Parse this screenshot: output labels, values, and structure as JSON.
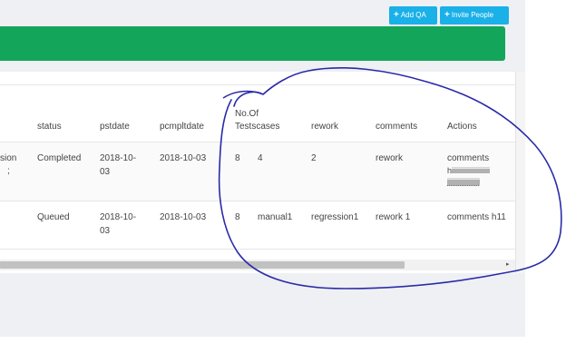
{
  "toolbar": {
    "add_qa_label": "Add QA",
    "invite_label": "Invite People",
    "plus_glyph": "+"
  },
  "table": {
    "headers": {
      "status": "status",
      "pstdate": "pstdate",
      "pcmpltdate": "pcmpltdate",
      "no_of_line1": "No.Of",
      "testcases": "Testscases",
      "rework": "rework",
      "comments": "comments",
      "actions": "Actions"
    },
    "rows": [
      {
        "partial_left_line1": "sion",
        "partial_left_line2": ";",
        "status": "Completed",
        "pstdate_line1": "2018-10-",
        "pstdate_line2": "03",
        "pcmpltdate": "2018-10-03",
        "no_of": "8",
        "testcases": "4",
        "rework": "2",
        "comments": "rework",
        "actions_line1": "comments",
        "actions_line2": "hiiiiiiiiiiiiiiiiiiiii",
        "actions_line3": "jjjjjjjjjjjjjjjjjj"
      },
      {
        "status": "Queued",
        "pstdate_line1": "2018-10-",
        "pstdate_line2": "03",
        "pcmpltdate": "2018-10-03",
        "no_of": "8",
        "testcases": "manual1",
        "rework": "regression1",
        "comments": "rework 1",
        "actions": "comments h11"
      }
    ]
  },
  "colors": {
    "button": "#1ab0e8",
    "banner": "#13a55a",
    "annotation_ink": "#2a2aa8"
  },
  "scroll_arrow_glyph": "▸",
  "horizontal_scroll_position": 0.0,
  "annotation": "hand-drawn circle"
}
